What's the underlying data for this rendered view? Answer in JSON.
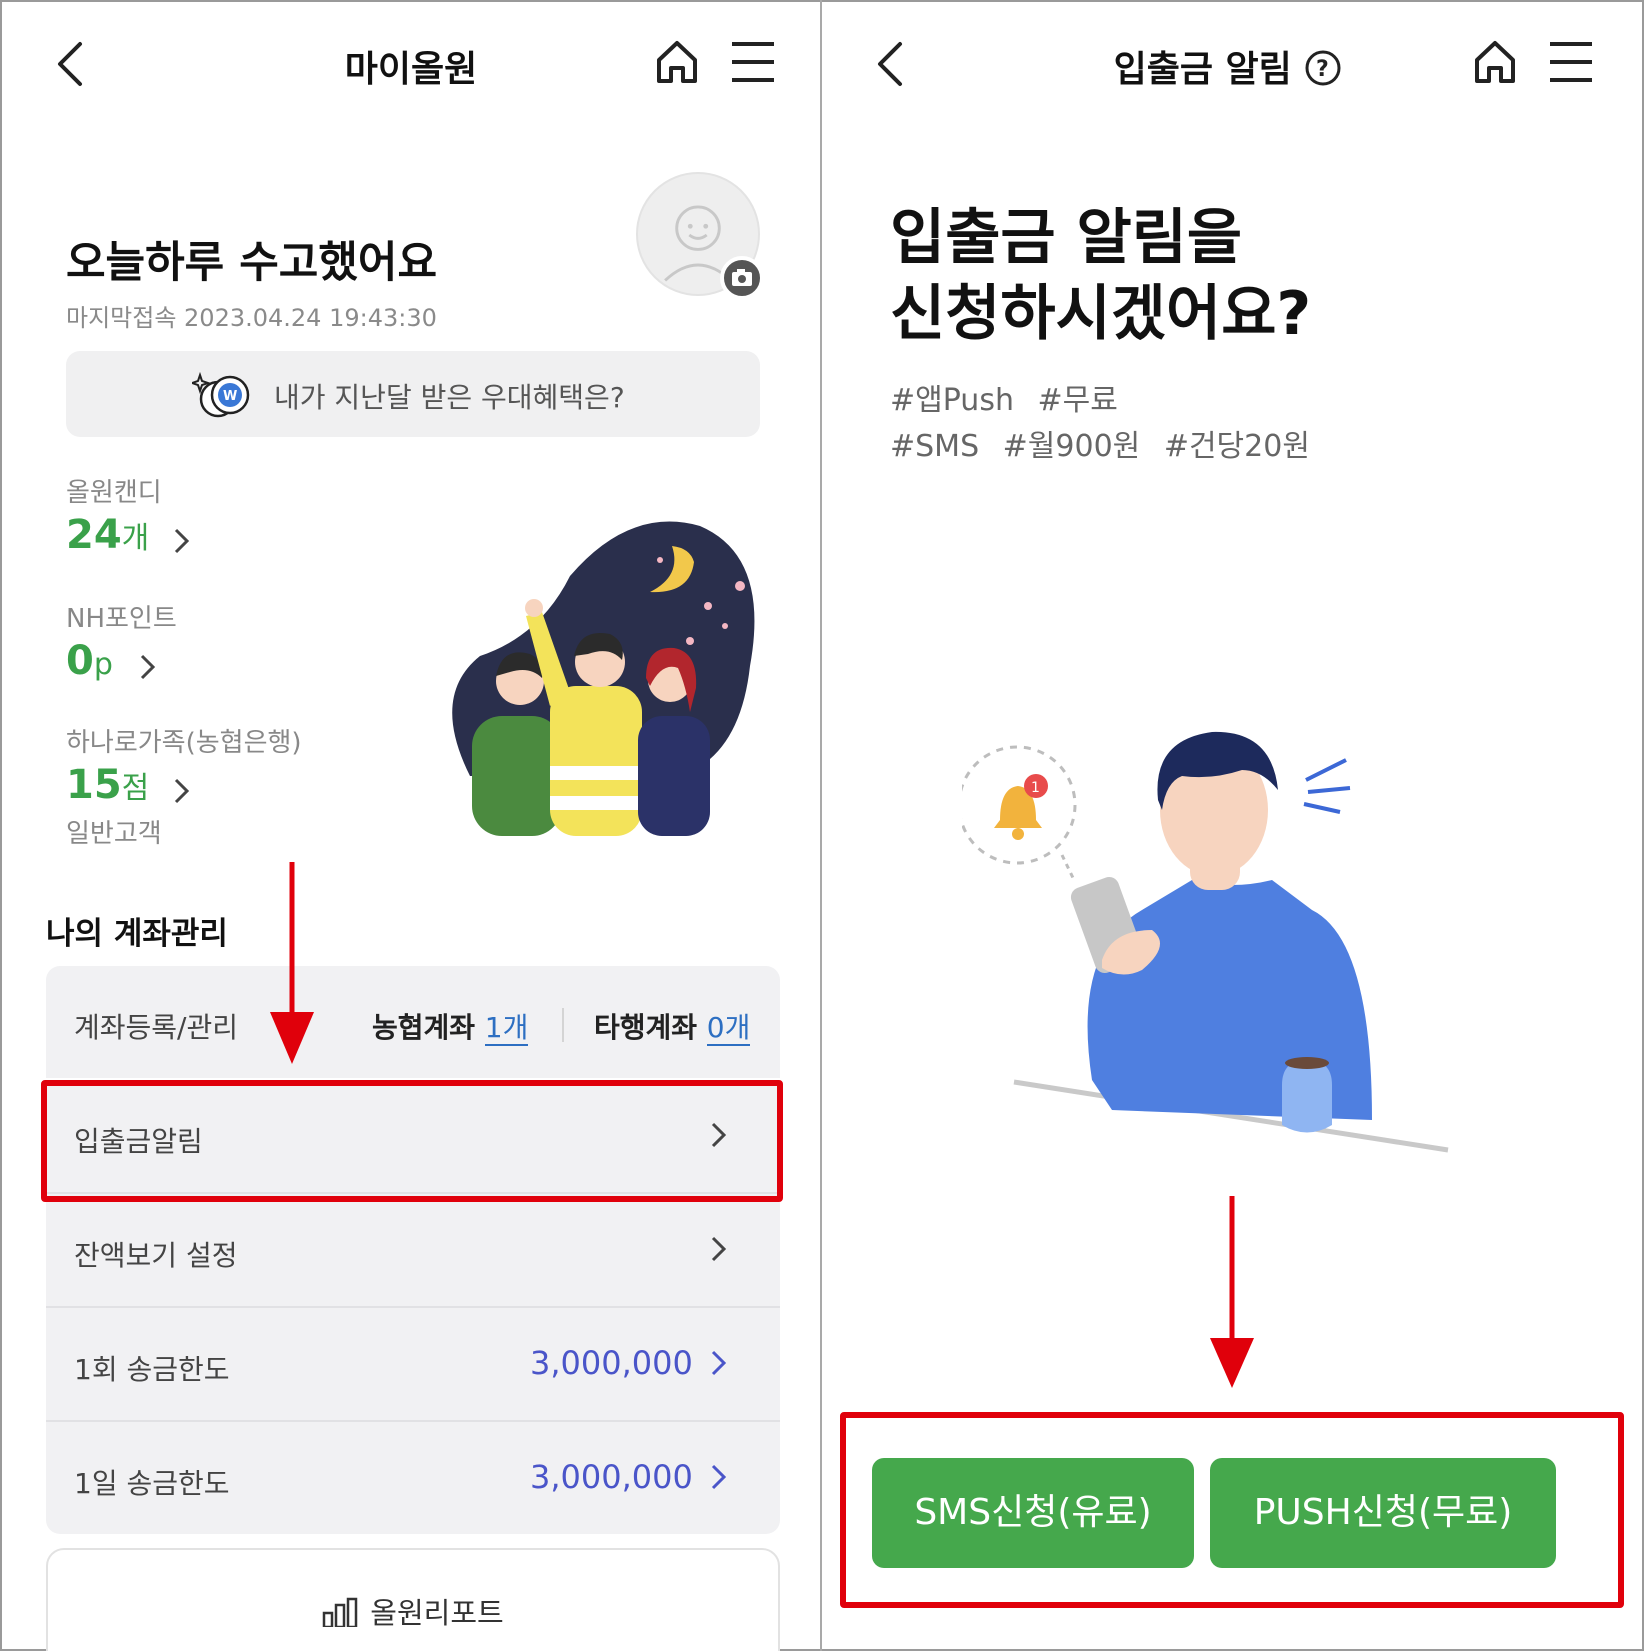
{
  "left": {
    "header": {
      "title": "마이올원"
    },
    "greeting": "오늘하루 수고했어요",
    "last_login": "마지막접속 2023.04.24 19:43:30",
    "benefit_banner": "내가 지난달 받은 우대혜택은?",
    "candy": {
      "label": "올원캔디",
      "value": "24",
      "unit": "개"
    },
    "nh_point": {
      "label": "NH포인트",
      "value": "0",
      "unit": "p"
    },
    "family": {
      "label": "하나로가족(농협은행)",
      "value": "15",
      "unit": "점",
      "grade": "일반고객"
    },
    "section_title": "나의 계좌관리",
    "account_mgmt": {
      "label": "계좌등록/관리",
      "nh_label": "농협계좌",
      "nh_count": "1개",
      "other_label": "타행계좌",
      "other_count": "0개"
    },
    "menu_items": [
      {
        "label": "입출금알림"
      },
      {
        "label": "잔액보기 설정"
      },
      {
        "label": "1회 송금한도",
        "amount": "3,000,000"
      },
      {
        "label": "1일 송금한도",
        "amount": "3,000,000"
      }
    ],
    "report_label": "올원리포트"
  },
  "right": {
    "header": {
      "title": "입출금 알림"
    },
    "question_line1": "입출금 알림을",
    "question_line2": "신청하시겠어요?",
    "tags_line1": [
      "#앱Push",
      "#무료"
    ],
    "tags_line2": [
      "#SMS",
      "#월900원",
      "#건당20원"
    ],
    "notif_badge": "1",
    "buttons": {
      "sms": "SMS신청(유료)",
      "push": "PUSH신청(무료)"
    }
  },
  "colors": {
    "accent_green": "#45a84c",
    "amount_blue": "#4a55c9",
    "count_blue": "#2d6fc2",
    "highlight_red": "#e0000b"
  }
}
